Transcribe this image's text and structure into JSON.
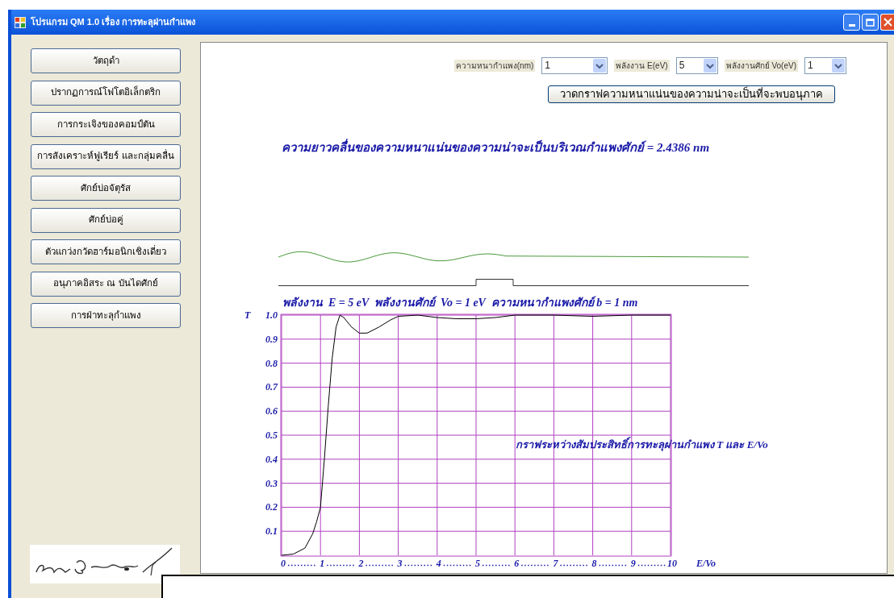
{
  "window": {
    "title": "โปรแกรม QM 1.0 เรื่อง การทะลุผ่านกำแพง"
  },
  "sidebar": {
    "items": [
      {
        "label": "วัตถุดำ"
      },
      {
        "label": "ปรากฏการณ์โฟโตอิเล็กตริก"
      },
      {
        "label": "การกระเจิงของคอมป์ตัน"
      },
      {
        "label": "การสังเคราะห์ฟูเรียร์ และกลุ่มคลื่น"
      },
      {
        "label": "ศักย์บ่อจัตุรัส"
      },
      {
        "label": "ศักย์บ่อคู่"
      },
      {
        "label": "ตัวแกว่งกวัดฮาร์มอนิกเชิงเดี่ยว"
      },
      {
        "label": "อนุภาคอิสระ ณ บันไดศักย์"
      },
      {
        "label": "การฝ่าทะลุกำแพง"
      }
    ]
  },
  "controls": [
    {
      "label": "ความหนากำแพง(nm)",
      "value": "1"
    },
    {
      "label": "พลังงาน E(eV)",
      "value": "5"
    },
    {
      "label": "พลังงานศักย์ Vo(eV)",
      "value": "1"
    }
  ],
  "draw_button": {
    "label": "วาดกราฟความหนาแน่นของความน่าจะเป็นที่จะพบอนุภาค"
  },
  "result_text": "ความยาวคลื่นของความหนาแน่นของความน่าจะเป็นบริเวณกำแพงศักย์ = 2.4386 nm",
  "chart": {
    "heading": "พลังงาน  E = 5 eV  พลังงานศักย์  Vo = 1 eV  ความหนากำแพงศักย์ b = 1 nm",
    "chart_data": {
      "type": "line",
      "xlabel": "E/Vo",
      "ylabel": "T",
      "x": [
        0,
        0.3,
        0.6,
        0.8,
        0.9,
        1.0,
        1.1,
        1.2,
        1.3,
        1.4,
        1.5,
        1.6,
        1.8,
        2.0,
        2.2,
        2.5,
        2.8,
        3.0,
        3.5,
        4,
        4.5,
        5,
        5.5,
        6,
        7,
        8,
        9,
        10
      ],
      "values": [
        0,
        0.005,
        0.03,
        0.09,
        0.14,
        0.2,
        0.4,
        0.62,
        0.82,
        0.95,
        1.0,
        0.99,
        0.95,
        0.925,
        0.925,
        0.95,
        0.98,
        0.995,
        1.0,
        0.99,
        0.985,
        0.985,
        0.99,
        1.0,
        1.0,
        0.995,
        1.0,
        1.0
      ],
      "grid": true,
      "xlim": [
        0,
        10
      ],
      "ylim": [
        0,
        1
      ],
      "xticks": [
        0,
        1,
        2,
        3,
        4,
        5,
        6,
        7,
        8,
        9,
        10
      ],
      "yticks": [
        0.1,
        0.2,
        0.3,
        0.4,
        0.5,
        0.6,
        0.7,
        0.8,
        0.9,
        {
          "value": 1,
          "label": "1.0"
        }
      ],
      "annotations": [
        {
          "text": "กราฟระหว่างสัมประสิทธิ์การทะลุผ่านกำแพง T และ  E/Vo"
        }
      ]
    }
  }
}
